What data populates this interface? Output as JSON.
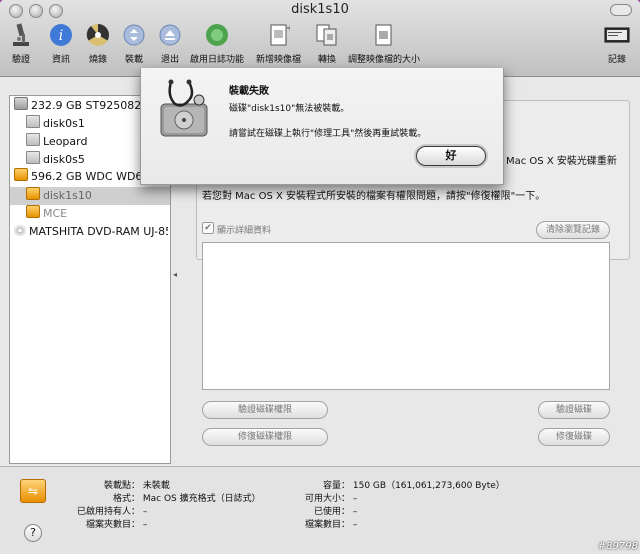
{
  "window": {
    "title": "disk1s10"
  },
  "toolbar": {
    "items": [
      {
        "label": "驗證"
      },
      {
        "label": "資訊"
      },
      {
        "label": "燒錄"
      },
      {
        "label": "裝載"
      },
      {
        "label": "退出"
      },
      {
        "label": "啟用日誌功能"
      },
      {
        "label": "新增映像檔"
      },
      {
        "label": "轉換"
      },
      {
        "label": "調整映像檔的大小"
      }
    ],
    "log_label": "記錄"
  },
  "sidebar": {
    "items": [
      {
        "label": "232.9 GB ST9250827A"
      },
      {
        "label": "disk0s1"
      },
      {
        "label": "Leopard"
      },
      {
        "label": "disk0s5"
      },
      {
        "label": "596.2 GB WDC WD64"
      },
      {
        "label": "disk1s10"
      },
      {
        "label": "MCE"
      },
      {
        "label": "MATSHITA DVD-RAM UJ-85"
      }
    ]
  },
  "main": {
    "info_line1_tail": "Mac OS X 安裝光碟重新",
    "info_line2": "若您對 Mac OS X 安裝程式所安裝的檔案有權限問題，請按\"修復權限\"一下。",
    "show_details": "顯示詳細資料",
    "clear_log": "清除瀏覽記錄",
    "verify_permissions": "驗證磁碟權限",
    "repair_permissions": "修復磁碟權限",
    "verify_disk": "驗證磁碟",
    "repair_disk": "修復磁碟"
  },
  "status": {
    "mount_point_label": "裝載點：",
    "mount_point_value": "未裝載",
    "format_label": "格式：",
    "format_value": "Mac OS 擴充格式（日誌式）",
    "owners_label": "已啟用持有人：",
    "owners_value": "–",
    "folders_label": "檔案夾數目：",
    "folders_value": "–",
    "capacity_label": "容量：",
    "capacity_value": "150 GB（161,061,273,600 Byte）",
    "available_label": "可用大小：",
    "available_value": "–",
    "used_label": "已使用：",
    "used_value": "–",
    "files_label": "檔案數目：",
    "files_value": "–",
    "help": "?"
  },
  "dialog": {
    "title": "裝載失敗",
    "message": "磁碟\"disk1s10\"無法被裝載。",
    "detail": "請嘗試在磁碟上執行\"修理工具\"然後再重試裝載。",
    "ok": "好"
  },
  "watermark": "#89798",
  "colors": {
    "desktop": "#8e3d8f",
    "orange_volume": "#e69400"
  }
}
